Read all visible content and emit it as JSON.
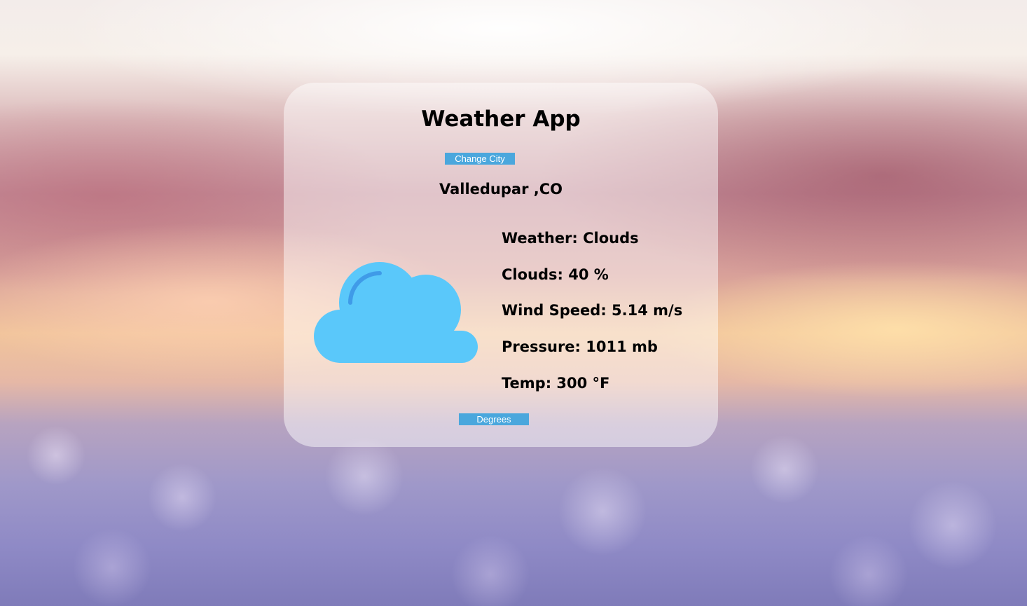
{
  "app": {
    "title": "Weather App"
  },
  "buttons": {
    "change_city_label": "Change City",
    "degrees_label": "Degrees"
  },
  "location": {
    "city": "Valledupar ,CO"
  },
  "weather_icon": "cloud-icon",
  "stats": [
    {
      "text": "Weather: Clouds"
    },
    {
      "text": "Clouds: 40 %"
    },
    {
      "text": "Wind Speed: 5.14 m/s"
    },
    {
      "text": "Pressure: 1011 mb"
    },
    {
      "text": "Temp: 300 °F"
    }
  ],
  "colors": {
    "button_bg": "#4aa7dd",
    "button_text": "#ffffff",
    "cloud_icon": "#5ac8fa",
    "cloud_icon_accent": "#3f9be8"
  }
}
